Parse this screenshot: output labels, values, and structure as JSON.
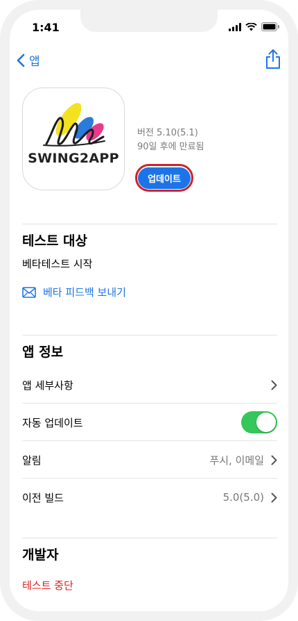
{
  "status_bar": {
    "time": "1:41"
  },
  "nav": {
    "back_label": "앱"
  },
  "app": {
    "icon_text": "SWING2APP",
    "version": "버전 5.10(5.1)",
    "expiry": "90일 후에 만료됨",
    "update_label": "업데이트"
  },
  "test": {
    "title": "테스트 대상",
    "status": "베타테스트 시작",
    "feedback_link": "베타 피드백 보내기"
  },
  "info": {
    "title": "앱 정보",
    "rows": [
      {
        "label": "앱 세부사항",
        "value": ""
      },
      {
        "label": "자동 업데이트",
        "value": ""
      },
      {
        "label": "알림",
        "value": "푸시, 이메일"
      },
      {
        "label": "이전 빌드",
        "value": "5.0(5.0)"
      }
    ],
    "auto_update_on": true
  },
  "developer": {
    "title": "개발자",
    "stop_label": "테스트 중단"
  },
  "colors": {
    "accent": "#1d74e8",
    "toggle_on": "#34c759",
    "danger": "#e02020"
  }
}
